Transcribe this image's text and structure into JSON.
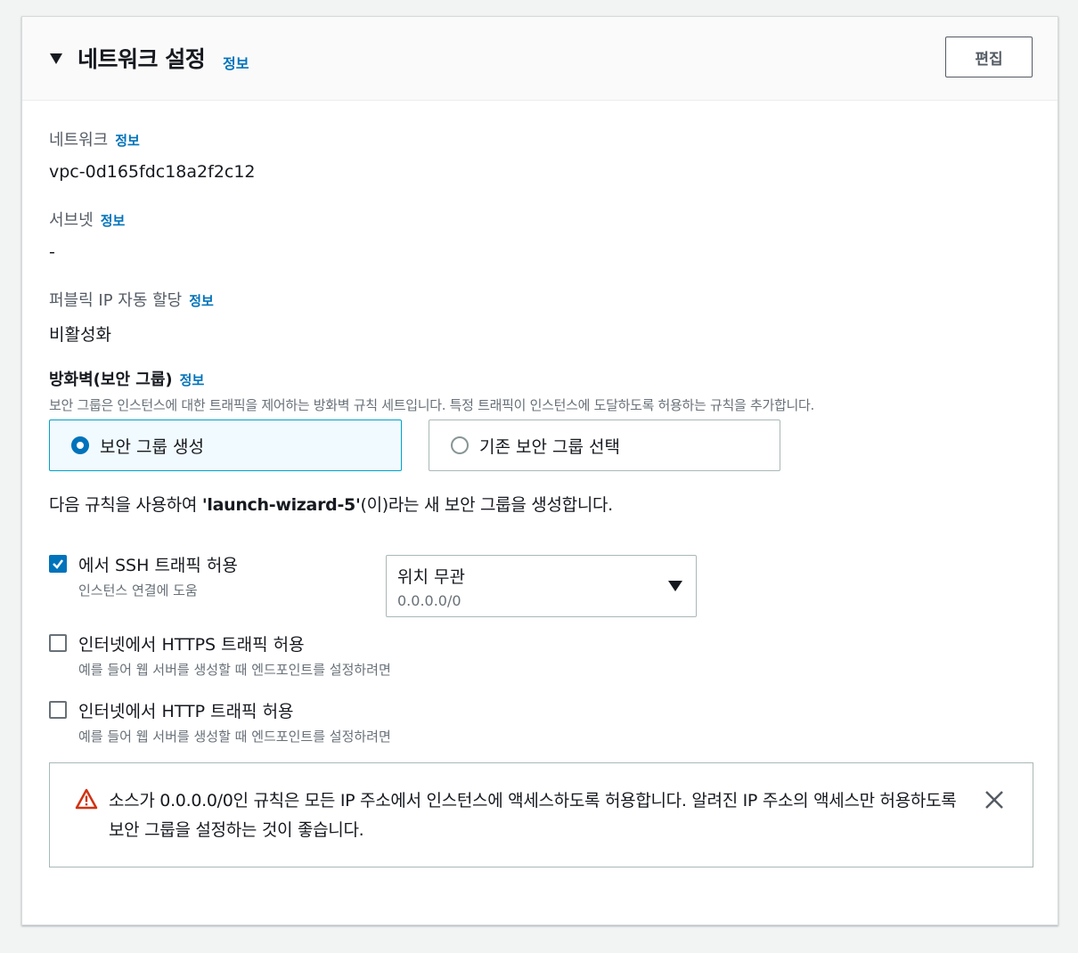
{
  "header": {
    "title": "네트워크 설정",
    "info": "정보",
    "edit_button": "편집"
  },
  "network": {
    "label": "네트워크",
    "info": "정보",
    "value": "vpc-0d165fdc18a2f2c12"
  },
  "subnet": {
    "label": "서브넷",
    "info": "정보",
    "value": "-"
  },
  "public_ip": {
    "label": "퍼블릭 IP 자동 할당",
    "info": "정보",
    "value": "비활성화"
  },
  "firewall": {
    "title": "방화벽(보안 그룹)",
    "info": "정보",
    "description": "보안 그룹은 인스턴스에 대한 트래픽을 제어하는 방화벽 규칙 세트입니다. 특정 트래픽이 인스턴스에 도달하도록 허용하는 규칙을 추가합니다.",
    "options": [
      {
        "label": "보안 그룹 생성",
        "selected": true
      },
      {
        "label": "기존 보안 그룹 선택",
        "selected": false
      }
    ],
    "rule_text_prefix": "다음 규칙을 사용하여 ",
    "group_name": "'launch-wizard-5'",
    "rule_text_suffix": "(이)라는 새 보안 그룹을 생성합니다."
  },
  "rules": [
    {
      "label": "에서 SSH 트래픽 허용",
      "description": "인스턴스 연결에 도움",
      "checked": true
    },
    {
      "label": "인터넷에서 HTTPS 트래픽 허용",
      "description": "예를 들어 웹 서버를 생성할 때 엔드포인트를 설정하려면",
      "checked": false
    },
    {
      "label": "인터넷에서 HTTP 트래픽 허용",
      "description": "예를 들어 웹 서버를 생성할 때 엔드포인트를 설정하려면",
      "checked": false
    }
  ],
  "source_select": {
    "label": "위치 무관",
    "value": "0.0.0.0/0"
  },
  "alert": {
    "text": "소스가 0.0.0.0/0인 규칙은 모든 IP 주소에서 인스턴스에 액세스하도록 허용합니다. 알려진 IP 주소의 액세스만 허용하도록 보안 그룹을 설정하는 것이 좋습니다."
  },
  "colors": {
    "accent": "#0073bb",
    "warning": "#d13212",
    "selected_tile_bg": "#f1faff"
  },
  "icons": {
    "caret": "caret-down-icon",
    "warning": "warning-icon",
    "close": "close-icon",
    "dropdown": "dropdown-caret-icon"
  }
}
